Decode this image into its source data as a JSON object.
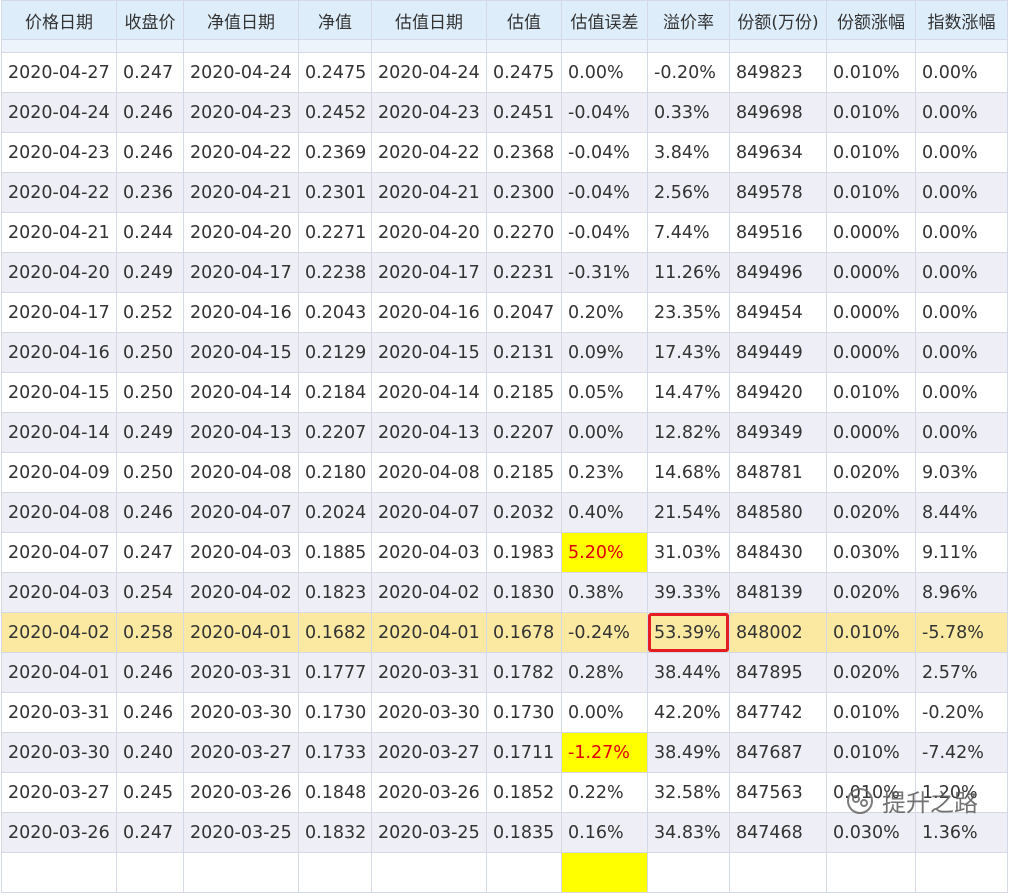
{
  "headers": [
    "价格日期",
    "收盘价",
    "净值日期",
    "净值",
    "估值日期",
    "估值",
    "估值误差",
    "溢价率",
    "份额(万份)",
    "份额涨幅",
    "指数涨幅"
  ],
  "rows": [
    [
      "2020-04-27",
      "0.247",
      "2020-04-24",
      "0.2475",
      "2020-04-24",
      "0.2475",
      "0.00%",
      "-0.20%",
      "849823",
      "0.010%",
      "0.00%"
    ],
    [
      "2020-04-24",
      "0.246",
      "2020-04-23",
      "0.2452",
      "2020-04-23",
      "0.2451",
      "-0.04%",
      "0.33%",
      "849698",
      "0.010%",
      "0.00%"
    ],
    [
      "2020-04-23",
      "0.246",
      "2020-04-22",
      "0.2369",
      "2020-04-22",
      "0.2368",
      "-0.04%",
      "3.84%",
      "849634",
      "0.010%",
      "0.00%"
    ],
    [
      "2020-04-22",
      "0.236",
      "2020-04-21",
      "0.2301",
      "2020-04-21",
      "0.2300",
      "-0.04%",
      "2.56%",
      "849578",
      "0.010%",
      "0.00%"
    ],
    [
      "2020-04-21",
      "0.244",
      "2020-04-20",
      "0.2271",
      "2020-04-20",
      "0.2270",
      "-0.04%",
      "7.44%",
      "849516",
      "0.000%",
      "0.00%"
    ],
    [
      "2020-04-20",
      "0.249",
      "2020-04-17",
      "0.2238",
      "2020-04-17",
      "0.2231",
      "-0.31%",
      "11.26%",
      "849496",
      "0.000%",
      "0.00%"
    ],
    [
      "2020-04-17",
      "0.252",
      "2020-04-16",
      "0.2043",
      "2020-04-16",
      "0.2047",
      "0.20%",
      "23.35%",
      "849454",
      "0.000%",
      "0.00%"
    ],
    [
      "2020-04-16",
      "0.250",
      "2020-04-15",
      "0.2129",
      "2020-04-15",
      "0.2131",
      "0.09%",
      "17.43%",
      "849449",
      "0.000%",
      "0.00%"
    ],
    [
      "2020-04-15",
      "0.250",
      "2020-04-14",
      "0.2184",
      "2020-04-14",
      "0.2185",
      "0.05%",
      "14.47%",
      "849420",
      "0.010%",
      "0.00%"
    ],
    [
      "2020-04-14",
      "0.249",
      "2020-04-13",
      "0.2207",
      "2020-04-13",
      "0.2207",
      "0.00%",
      "12.82%",
      "849349",
      "0.000%",
      "0.00%"
    ],
    [
      "2020-04-09",
      "0.250",
      "2020-04-08",
      "0.2180",
      "2020-04-08",
      "0.2185",
      "0.23%",
      "14.68%",
      "848781",
      "0.020%",
      "9.03%"
    ],
    [
      "2020-04-08",
      "0.246",
      "2020-04-07",
      "0.2024",
      "2020-04-07",
      "0.2032",
      "0.40%",
      "21.54%",
      "848580",
      "0.020%",
      "8.44%"
    ],
    [
      "2020-04-07",
      "0.247",
      "2020-04-03",
      "0.1885",
      "2020-04-03",
      "0.1983",
      "5.20%",
      "31.03%",
      "848430",
      "0.030%",
      "9.11%"
    ],
    [
      "2020-04-03",
      "0.254",
      "2020-04-02",
      "0.1823",
      "2020-04-02",
      "0.1830",
      "0.38%",
      "39.33%",
      "848139",
      "0.020%",
      "8.96%"
    ],
    [
      "2020-04-02",
      "0.258",
      "2020-04-01",
      "0.1682",
      "2020-04-01",
      "0.1678",
      "-0.24%",
      "53.39%",
      "848002",
      "0.010%",
      "-5.78%"
    ],
    [
      "2020-04-01",
      "0.246",
      "2020-03-31",
      "0.1777",
      "2020-03-31",
      "0.1782",
      "0.28%",
      "38.44%",
      "847895",
      "0.020%",
      "2.57%"
    ],
    [
      "2020-03-31",
      "0.246",
      "2020-03-30",
      "0.1730",
      "2020-03-30",
      "0.1730",
      "0.00%",
      "42.20%",
      "847742",
      "0.010%",
      "-0.20%"
    ],
    [
      "2020-03-30",
      "0.240",
      "2020-03-27",
      "0.1733",
      "2020-03-27",
      "0.1711",
      "-1.27%",
      "38.49%",
      "847687",
      "0.010%",
      "-7.42%"
    ],
    [
      "2020-03-27",
      "0.245",
      "2020-03-26",
      "0.1848",
      "2020-03-26",
      "0.1852",
      "0.22%",
      "32.58%",
      "847563",
      "0.010%",
      "1.20%"
    ],
    [
      "2020-03-26",
      "0.247",
      "2020-03-25",
      "0.1832",
      "2020-03-25",
      "0.1835",
      "0.16%",
      "34.83%",
      "847468",
      "0.030%",
      "1.36%"
    ]
  ],
  "highlighted_row_index": 14,
  "warn_cells": [
    [
      12,
      6
    ],
    [
      17,
      6
    ]
  ],
  "boxed_cells": [
    [
      14,
      7
    ]
  ],
  "colors": {
    "header_bg": "#deedfa",
    "row_alt_bg": "#eeeef6",
    "highlight_row_bg": "#fbe9a1",
    "warn_bg": "#ffff00",
    "warn_text": "#e00000",
    "box_border": "#e51c23"
  },
  "watermark": {
    "icon": "wechat-official-account-icon",
    "text": "提升之路"
  }
}
